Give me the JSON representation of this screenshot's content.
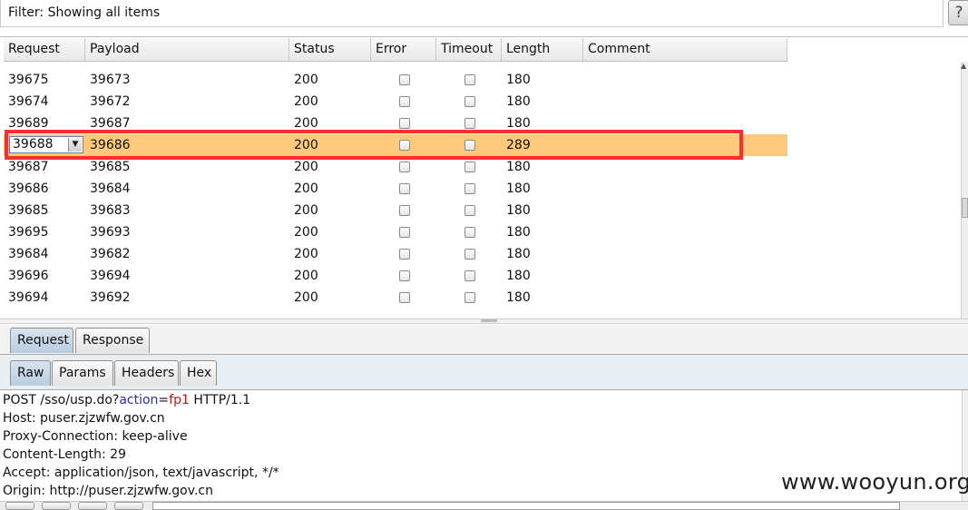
{
  "filter": {
    "text": "Filter: Showing all items",
    "help_label": "?"
  },
  "table": {
    "columns": [
      "Request",
      "Payload",
      "Status",
      "Error",
      "Timeout",
      "Length",
      "Comment"
    ],
    "rows": [
      {
        "request": "39675",
        "payload": "39673",
        "status": "200",
        "length": "180"
      },
      {
        "request": "39674",
        "payload": "39672",
        "status": "200",
        "length": "180"
      },
      {
        "request": "39689",
        "payload": "39687",
        "status": "200",
        "length": "180"
      },
      {
        "request": "39688",
        "payload": "39686",
        "status": "200",
        "length": "289",
        "selected": true
      },
      {
        "request": "39687",
        "payload": "39685",
        "status": "200",
        "length": "180"
      },
      {
        "request": "39686",
        "payload": "39684",
        "status": "200",
        "length": "180"
      },
      {
        "request": "39685",
        "payload": "39683",
        "status": "200",
        "length": "180"
      },
      {
        "request": "39695",
        "payload": "39693",
        "status": "200",
        "length": "180"
      },
      {
        "request": "39684",
        "payload": "39682",
        "status": "200",
        "length": "180"
      },
      {
        "request": "39696",
        "payload": "39694",
        "status": "200",
        "length": "180"
      },
      {
        "request": "39694",
        "payload": "39692",
        "status": "200",
        "length": "180"
      }
    ]
  },
  "tabs": {
    "outer": [
      "Request",
      "Response"
    ],
    "inner": [
      "Raw",
      "Params",
      "Headers",
      "Hex"
    ]
  },
  "request": {
    "line1": {
      "prefix": "POST /sso/usp.do?",
      "param": "action",
      "eq": "=",
      "value": "fp1",
      "suffix": " HTTP/1.1"
    },
    "lines": [
      "Host: puser.zjzwfw.gov.cn",
      "Proxy-Connection: keep-alive",
      "Content-Length: 29",
      "Accept: application/json, text/javascript, */*",
      "Origin: http://puser.zjzwfw.gov.cn"
    ]
  },
  "watermark": "www.wooyun.org",
  "colors": {
    "selected_row": "#fec97d",
    "highlight_border": "#ff2d2d",
    "active_tab": "#c7d8e8"
  }
}
